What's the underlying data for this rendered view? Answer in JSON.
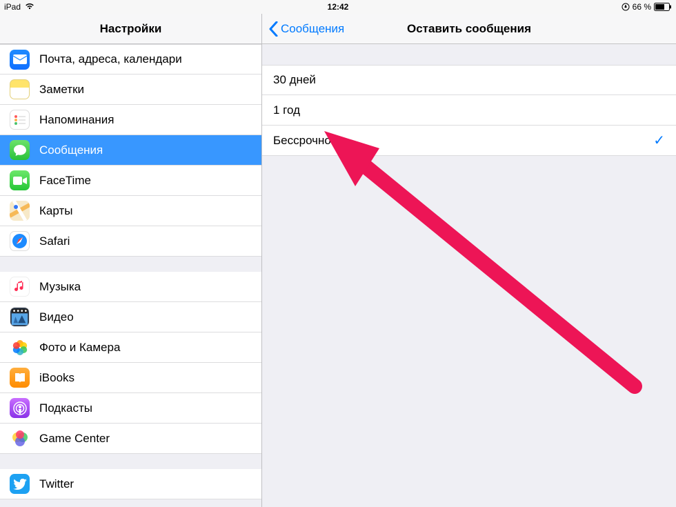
{
  "status": {
    "device": "iPad",
    "time": "12:42",
    "battery_text": "66 %"
  },
  "sidebar": {
    "title": "Настройки",
    "groups": [
      [
        {
          "id": "mail",
          "icon": "ic-mail",
          "label": "Почта, адреса, календари"
        },
        {
          "id": "notes",
          "icon": "ic-notes",
          "label": "Заметки"
        },
        {
          "id": "reminders",
          "icon": "ic-reminders",
          "label": "Напоминания"
        },
        {
          "id": "messages",
          "icon": "ic-messages",
          "label": "Сообщения",
          "selected": true
        },
        {
          "id": "facetime",
          "icon": "ic-facetime",
          "label": "FaceTime"
        },
        {
          "id": "maps",
          "icon": "ic-maps",
          "label": "Карты"
        },
        {
          "id": "safari",
          "icon": "ic-safari",
          "label": "Safari"
        }
      ],
      [
        {
          "id": "music",
          "icon": "ic-music",
          "label": "Музыка"
        },
        {
          "id": "video",
          "icon": "ic-video",
          "label": "Видео"
        },
        {
          "id": "photos",
          "icon": "ic-photos",
          "label": "Фото и Камера"
        },
        {
          "id": "ibooks",
          "icon": "ic-ibooks",
          "label": "iBooks"
        },
        {
          "id": "podcasts",
          "icon": "ic-podcasts",
          "label": "Подкасты"
        },
        {
          "id": "gamecenter",
          "icon": "ic-gamecenter",
          "label": "Game Center"
        }
      ],
      [
        {
          "id": "twitter",
          "icon": "ic-twitter",
          "label": "Twitter"
        }
      ]
    ]
  },
  "detail": {
    "back_label": "Сообщения",
    "title": "Оставить сообщения",
    "options": [
      {
        "label": "30 дней",
        "selected": false
      },
      {
        "label": "1 год",
        "selected": false
      },
      {
        "label": "Бессрочно",
        "selected": true
      }
    ]
  }
}
